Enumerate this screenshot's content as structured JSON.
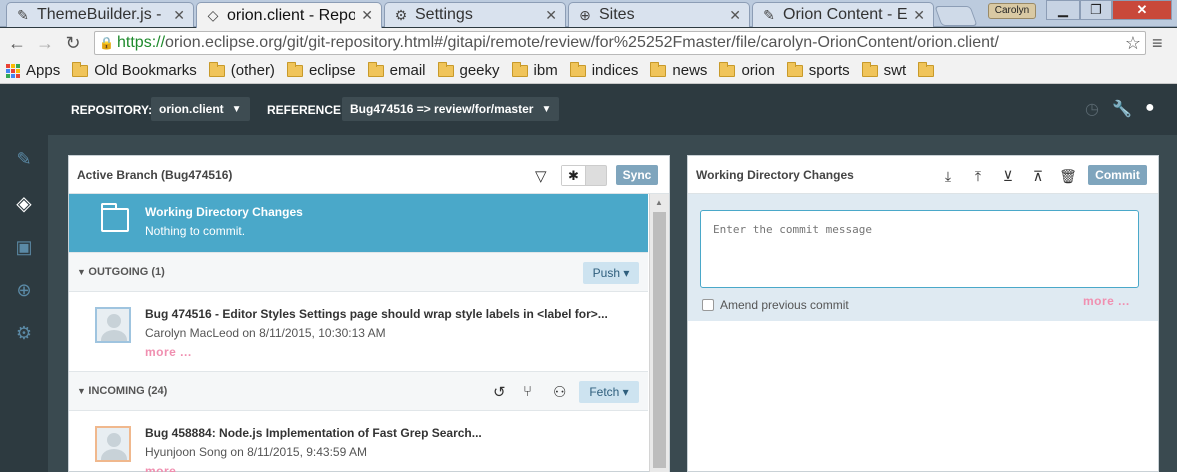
{
  "browser": {
    "tabs": [
      {
        "title": "ThemeBuilder.js - Ed",
        "icon": "pencil-icon",
        "active": false
      },
      {
        "title": "orion.client - Repos",
        "icon": "git-icon",
        "active": true
      },
      {
        "title": "Settings",
        "icon": "gear-icon",
        "active": false
      },
      {
        "title": "Sites",
        "icon": "globe-icon",
        "active": false
      },
      {
        "title": "Orion Content - Edi",
        "icon": "pencil-icon",
        "active": false
      }
    ],
    "profile_name": "Carolyn",
    "url_scheme": "https://",
    "url_rest": "orion.eclipse.org/git/git-repository.html#/gitapi/remote/review/for%25252Fmaster/file/carolyn-OrionContent/orion.client/",
    "bookmarks": [
      "Apps",
      "Old Bookmarks",
      "(other)",
      "eclipse",
      "email",
      "geeky",
      "ibm",
      "indices",
      "news",
      "orion",
      "sports",
      "swt",
      ""
    ]
  },
  "header": {
    "repository_label": "REPOSITORY:",
    "repository_value": "orion.client",
    "reference_label": "REFERENCE:",
    "reference_value": "Bug474516 => review/for/master"
  },
  "sidebar": {
    "items": [
      "edit-icon",
      "git-icon",
      "shell-icon",
      "globe-icon",
      "settings-icon"
    ],
    "active": "git-icon"
  },
  "left_panel": {
    "title": "Active Branch (Bug474516)",
    "sync_label": "Sync",
    "toggle_symbol": "✱",
    "wdc": {
      "title": "Working Directory Changes",
      "subtitle": "Nothing to commit."
    },
    "outgoing": {
      "title": "OUTGOING (1)",
      "push_label": "Push ▾",
      "commits": [
        {
          "title": "Bug 474516 - Editor Styles Settings page should wrap style labels in <label for>...",
          "meta": "Carolyn MacLeod on 8/11/2015, 10:30:13 AM",
          "more": "more ..."
        }
      ]
    },
    "incoming": {
      "title": "INCOMING (24)",
      "fetch_label": "Fetch ▾",
      "commits": [
        {
          "title": "Bug 458884: Node.js Implementation of Fast Grep Search...",
          "meta": "Hyunjoon Song on 8/11/2015, 9:43:59 AM",
          "more": "more ..."
        }
      ]
    }
  },
  "right_panel": {
    "title": "Working Directory Changes",
    "commit_label": "Commit",
    "commit_placeholder": "Enter the commit message",
    "amend_label": "Amend previous commit",
    "more": "more ..."
  },
  "colors": {
    "accent": "#4aa8c9",
    "header_bg": "#2d3a40",
    "link_pink": "#f08fb0"
  }
}
